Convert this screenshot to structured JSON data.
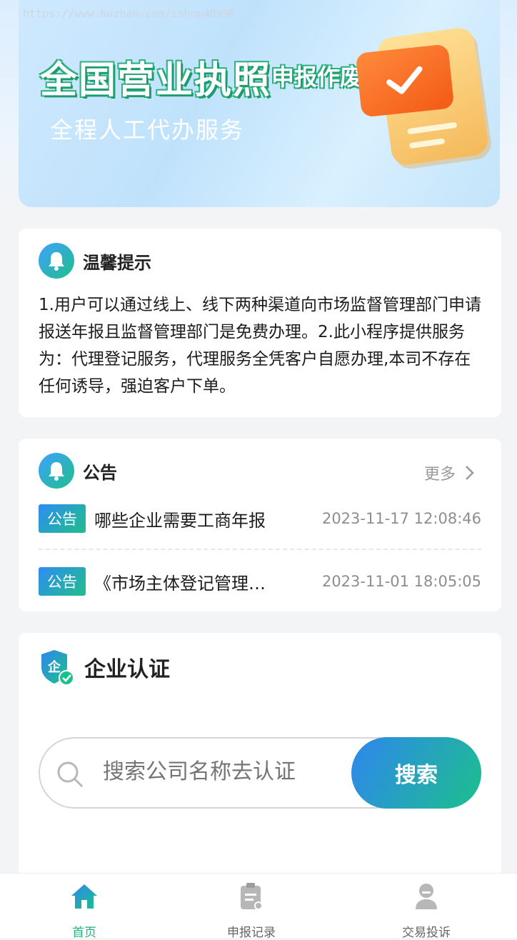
{
  "watermark": "https://www.huzhan.com/ishop48996",
  "banner": {
    "title": "全国营业执照",
    "tag": "申报作废",
    "subtitle": "全程人工代办服务"
  },
  "notice": {
    "title": "温馨提示",
    "text": "1.用户可以通过线上、线下两种渠道向市场监督管理部门申请报送年报且监督管理部门是免费办理。2.此小程序提供服务为：代理登记服务，代理服务全凭客户自愿办理,本司不存在任何诱导，强迫客户下单。"
  },
  "announcements": {
    "title": "公告",
    "more_label": "更多",
    "items": [
      {
        "tag": "公告",
        "title": "哪些企业需要工商年报",
        "time": "2023-11-17 12:08:46"
      },
      {
        "tag": "公告",
        "title": "《市场主体登记管理…",
        "time": "2023-11-01 18:05:05"
      }
    ]
  },
  "certification": {
    "title": "企业认证",
    "search_placeholder": "搜索公司名称去认证",
    "search_button": "搜索"
  },
  "tabbar": {
    "items": [
      {
        "label": "首页",
        "icon": "home-icon",
        "active": true
      },
      {
        "label": "申报记录",
        "icon": "clipboard-icon",
        "active": false
      },
      {
        "label": "交易投诉",
        "icon": "user-icon",
        "active": false
      }
    ],
    "active_color": "#1fb57c"
  }
}
